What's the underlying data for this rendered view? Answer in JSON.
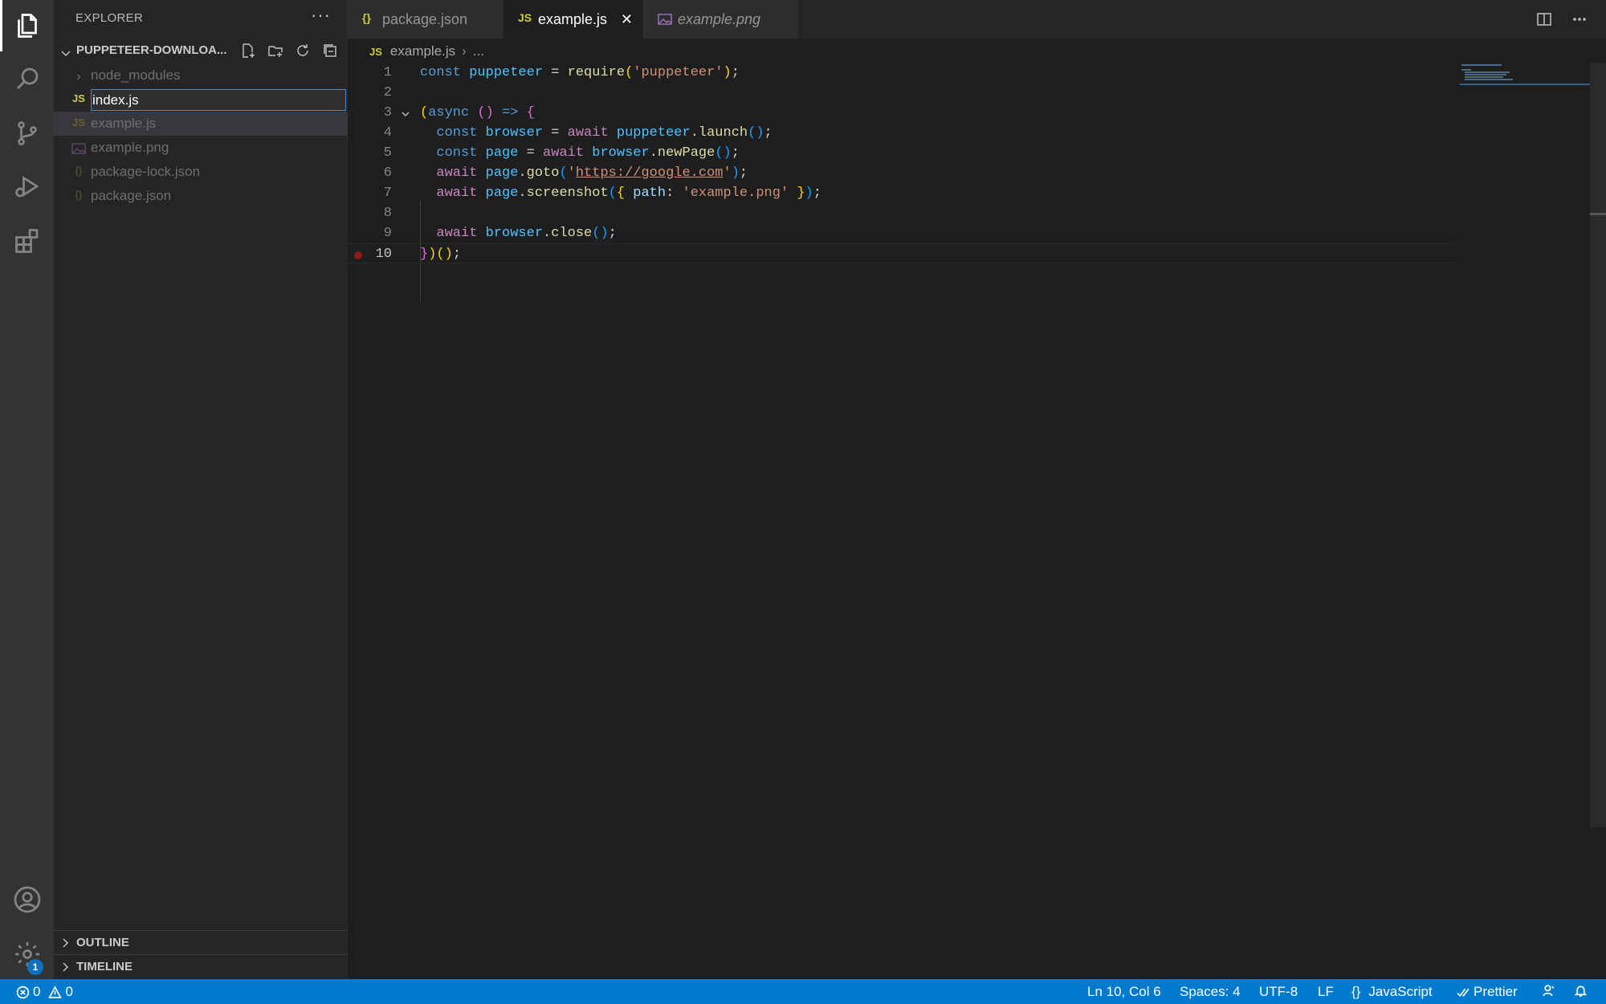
{
  "sidebar": {
    "title": "EXPLORER",
    "more": "···",
    "folder": "PUPPETEER-DOWNLOA...",
    "items": [
      {
        "label": "node_modules",
        "icon": "›"
      },
      {
        "label": "",
        "icon": "JS"
      },
      {
        "label": "example.js",
        "icon": "JS"
      },
      {
        "label": "example.png",
        "icon": "img"
      },
      {
        "label": "package-lock.json",
        "icon": "{}"
      },
      {
        "label": "package.json",
        "icon": "{}"
      }
    ],
    "rename_value": "index.js",
    "outline": "OUTLINE",
    "timeline": "TIMELINE"
  },
  "tabs": [
    {
      "label": "package.json",
      "icon": "{}"
    },
    {
      "label": "example.js",
      "icon": "JS",
      "close": "✕"
    },
    {
      "label": "example.png",
      "icon": "img"
    }
  ],
  "breadcrumb": {
    "icon": "JS",
    "file": "example.js",
    "sep": "›",
    "rest": "..."
  },
  "editor": {
    "line_numbers": [
      "1",
      "2",
      "3",
      "4",
      "5",
      "6",
      "7",
      "8",
      "9",
      "10"
    ]
  },
  "activity": {
    "badge": "1"
  },
  "status": {
    "errors": "0",
    "warnings": "0",
    "position": "Ln 10, Col 6",
    "spaces": "Spaces: 4",
    "encoding": "UTF-8",
    "eol": "LF",
    "language": "JavaScript",
    "language_icon": "{}",
    "formatter": "Prettier"
  },
  "colors": {
    "accent": "#007acc",
    "js_icon": "#cbcb41",
    "json_icon": "#cbcb41",
    "image_icon": "#a074c4"
  }
}
